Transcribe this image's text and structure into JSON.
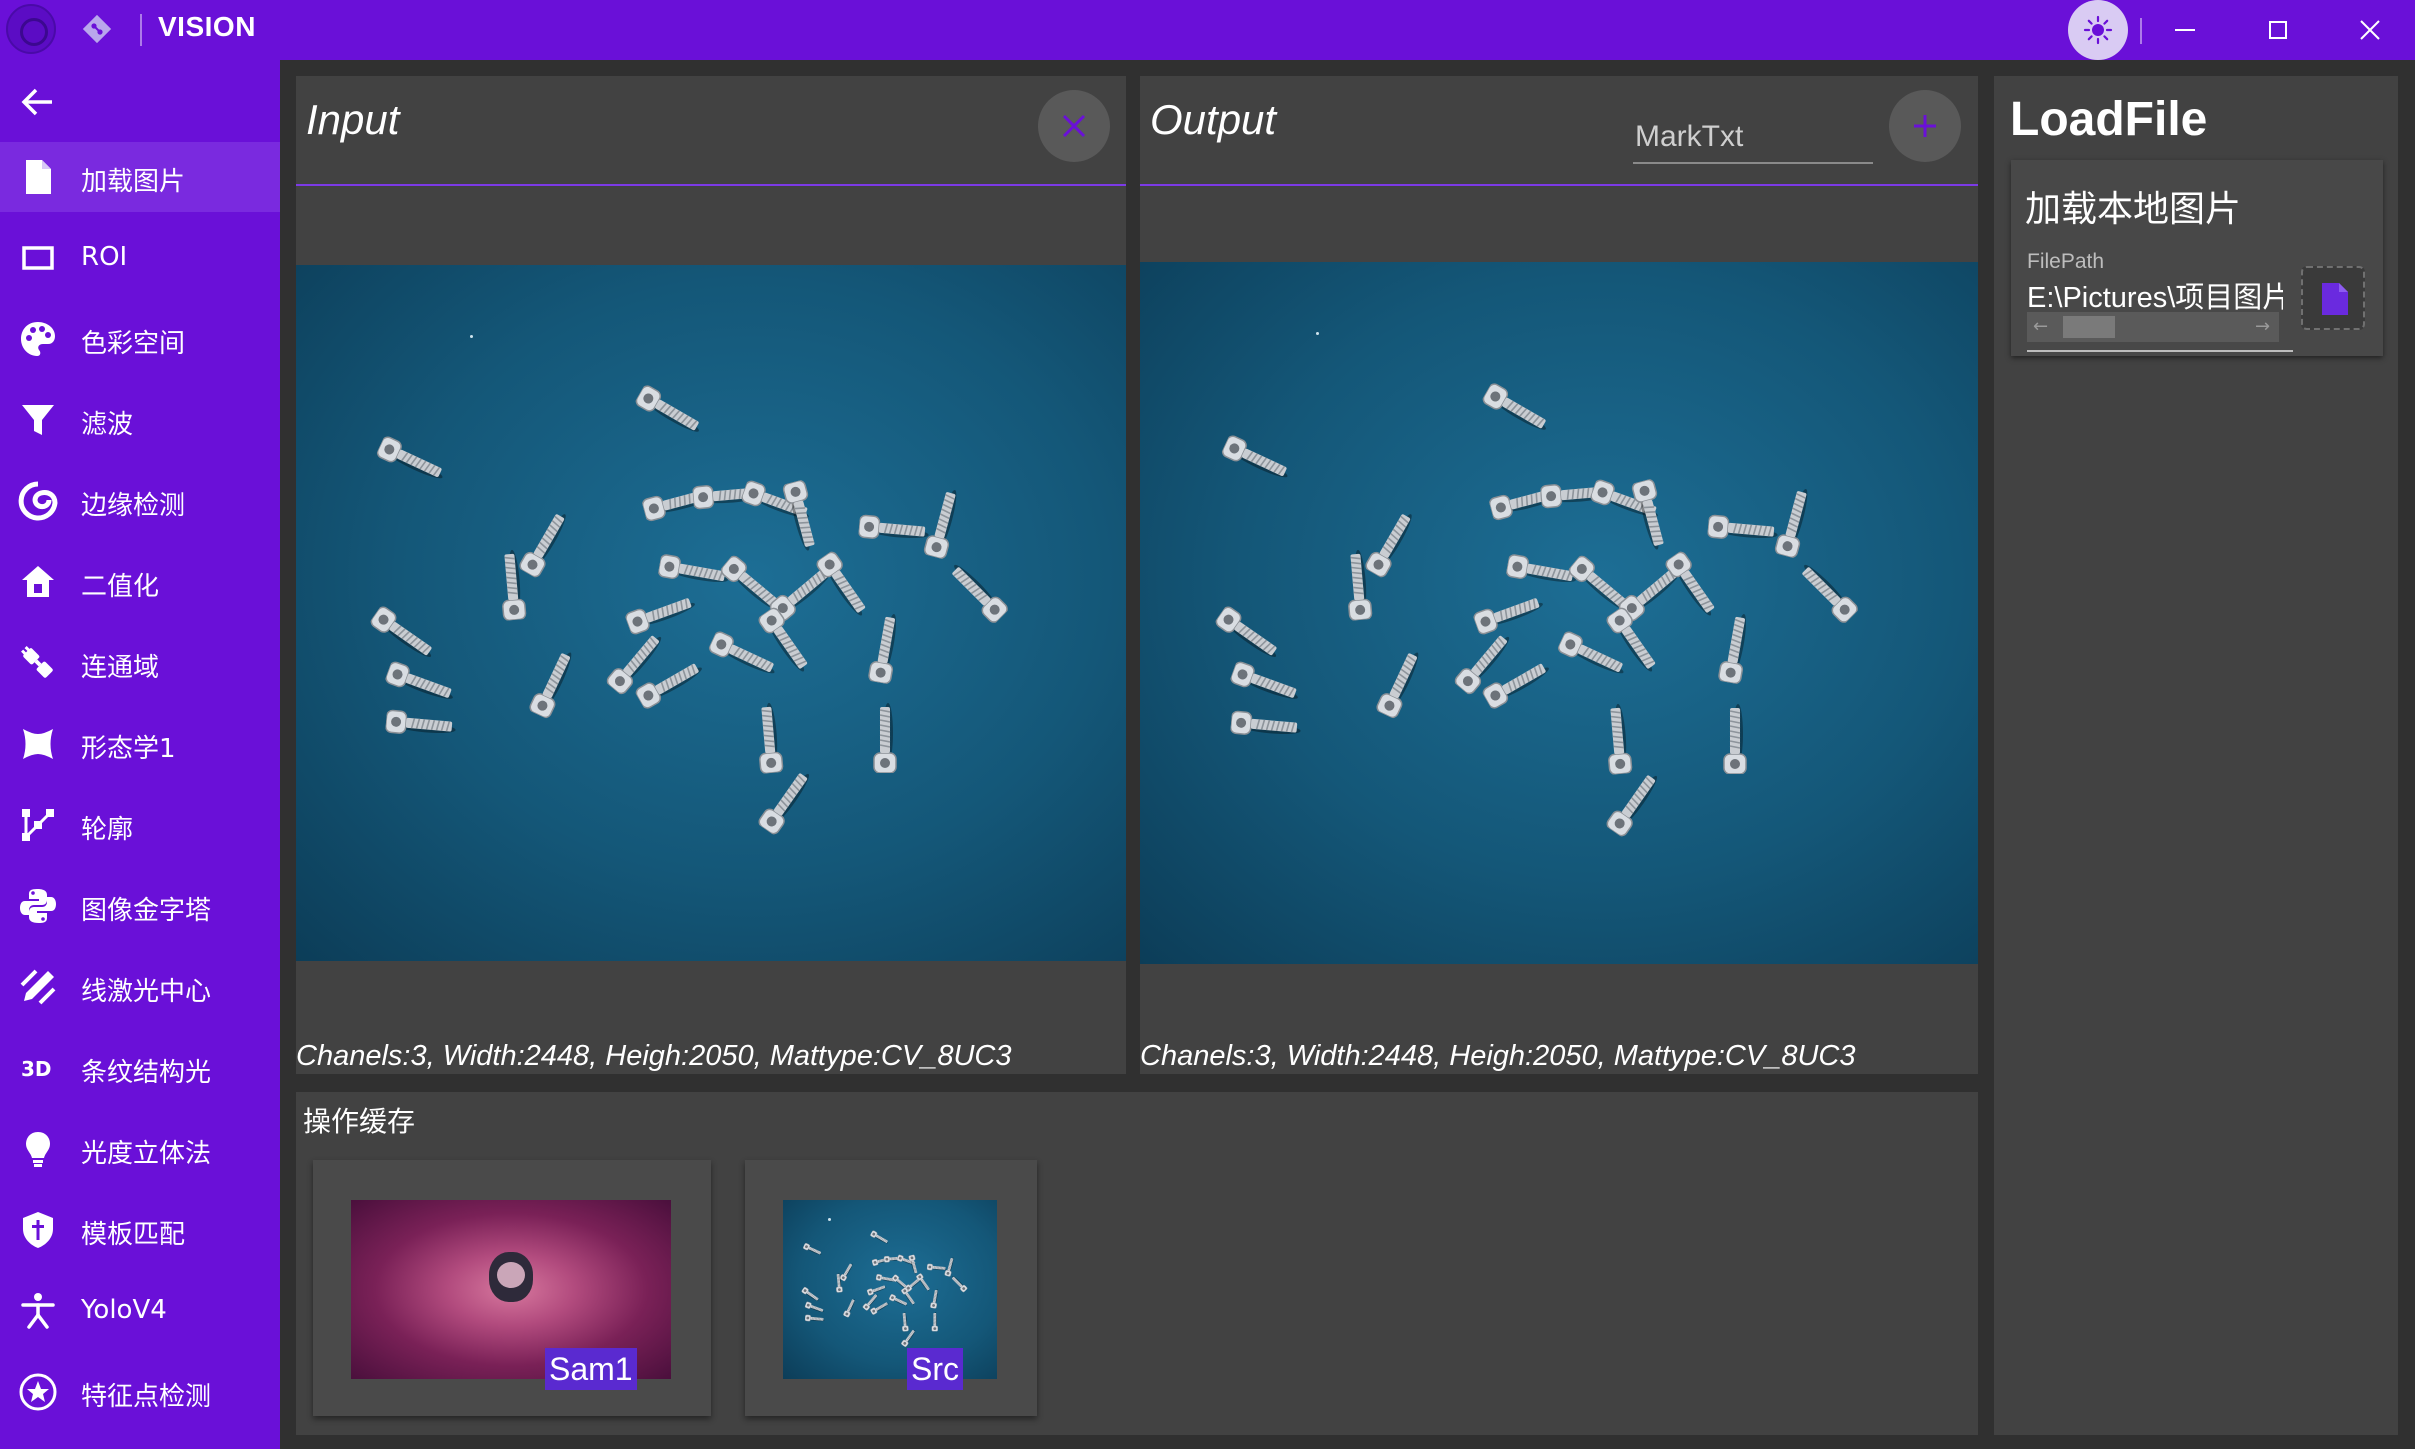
{
  "titlebar": {
    "title": "VISION",
    "accent_color": "#6a10d8",
    "controls": [
      "theme-toggle",
      "minimize",
      "maximize",
      "close"
    ]
  },
  "sidebar": {
    "back_icon": "arrow-left-icon",
    "items": [
      {
        "label": "加载图片",
        "icon": "file-icon"
      },
      {
        "label": "ROI",
        "icon": "rectangle-icon"
      },
      {
        "label": "色彩空间",
        "icon": "palette-icon"
      },
      {
        "label": "滤波",
        "icon": "filter-icon"
      },
      {
        "label": "边缘检测",
        "icon": "edge-icon"
      },
      {
        "label": "二值化",
        "icon": "home-icon"
      },
      {
        "label": "连通域",
        "icon": "connection-icon"
      },
      {
        "label": "形态学1",
        "icon": "morph-icon"
      },
      {
        "label": "轮廓",
        "icon": "contour-icon"
      },
      {
        "label": "图像金字塔",
        "icon": "python-icon"
      },
      {
        "label": "线激光中心",
        "icon": "laser-icon"
      },
      {
        "label": "条纹结构光",
        "icon": "3d-icon"
      },
      {
        "label": "光度立体法",
        "icon": "lightbulb-icon"
      },
      {
        "label": "模板匹配",
        "icon": "shield-icon"
      },
      {
        "label": "YoloV4",
        "icon": "person-icon"
      },
      {
        "label": "特征点检测",
        "icon": "star-icon"
      }
    ]
  },
  "input_panel": {
    "title": "Input",
    "info": "Chanels:3, Width:2448, Heigh:2050, Mattype:CV_8UC3",
    "action_icon": "close-icon"
  },
  "output_panel": {
    "title": "Output",
    "mark_placeholder": "MarkTxt",
    "info": "Chanels:3, Width:2448, Heigh:2050, Mattype:CV_8UC3",
    "action_icon": "plus-icon"
  },
  "cache": {
    "title": "操作缓存",
    "items": [
      {
        "label": "Sam1"
      },
      {
        "label": "Src"
      }
    ]
  },
  "right_panel": {
    "title": "LoadFile",
    "card_heading": "加载本地图片",
    "filepath_label": "FilePath",
    "filepath_value": "E:\\Pictures\\项目图片",
    "file_button_icon": "file-icon"
  }
}
